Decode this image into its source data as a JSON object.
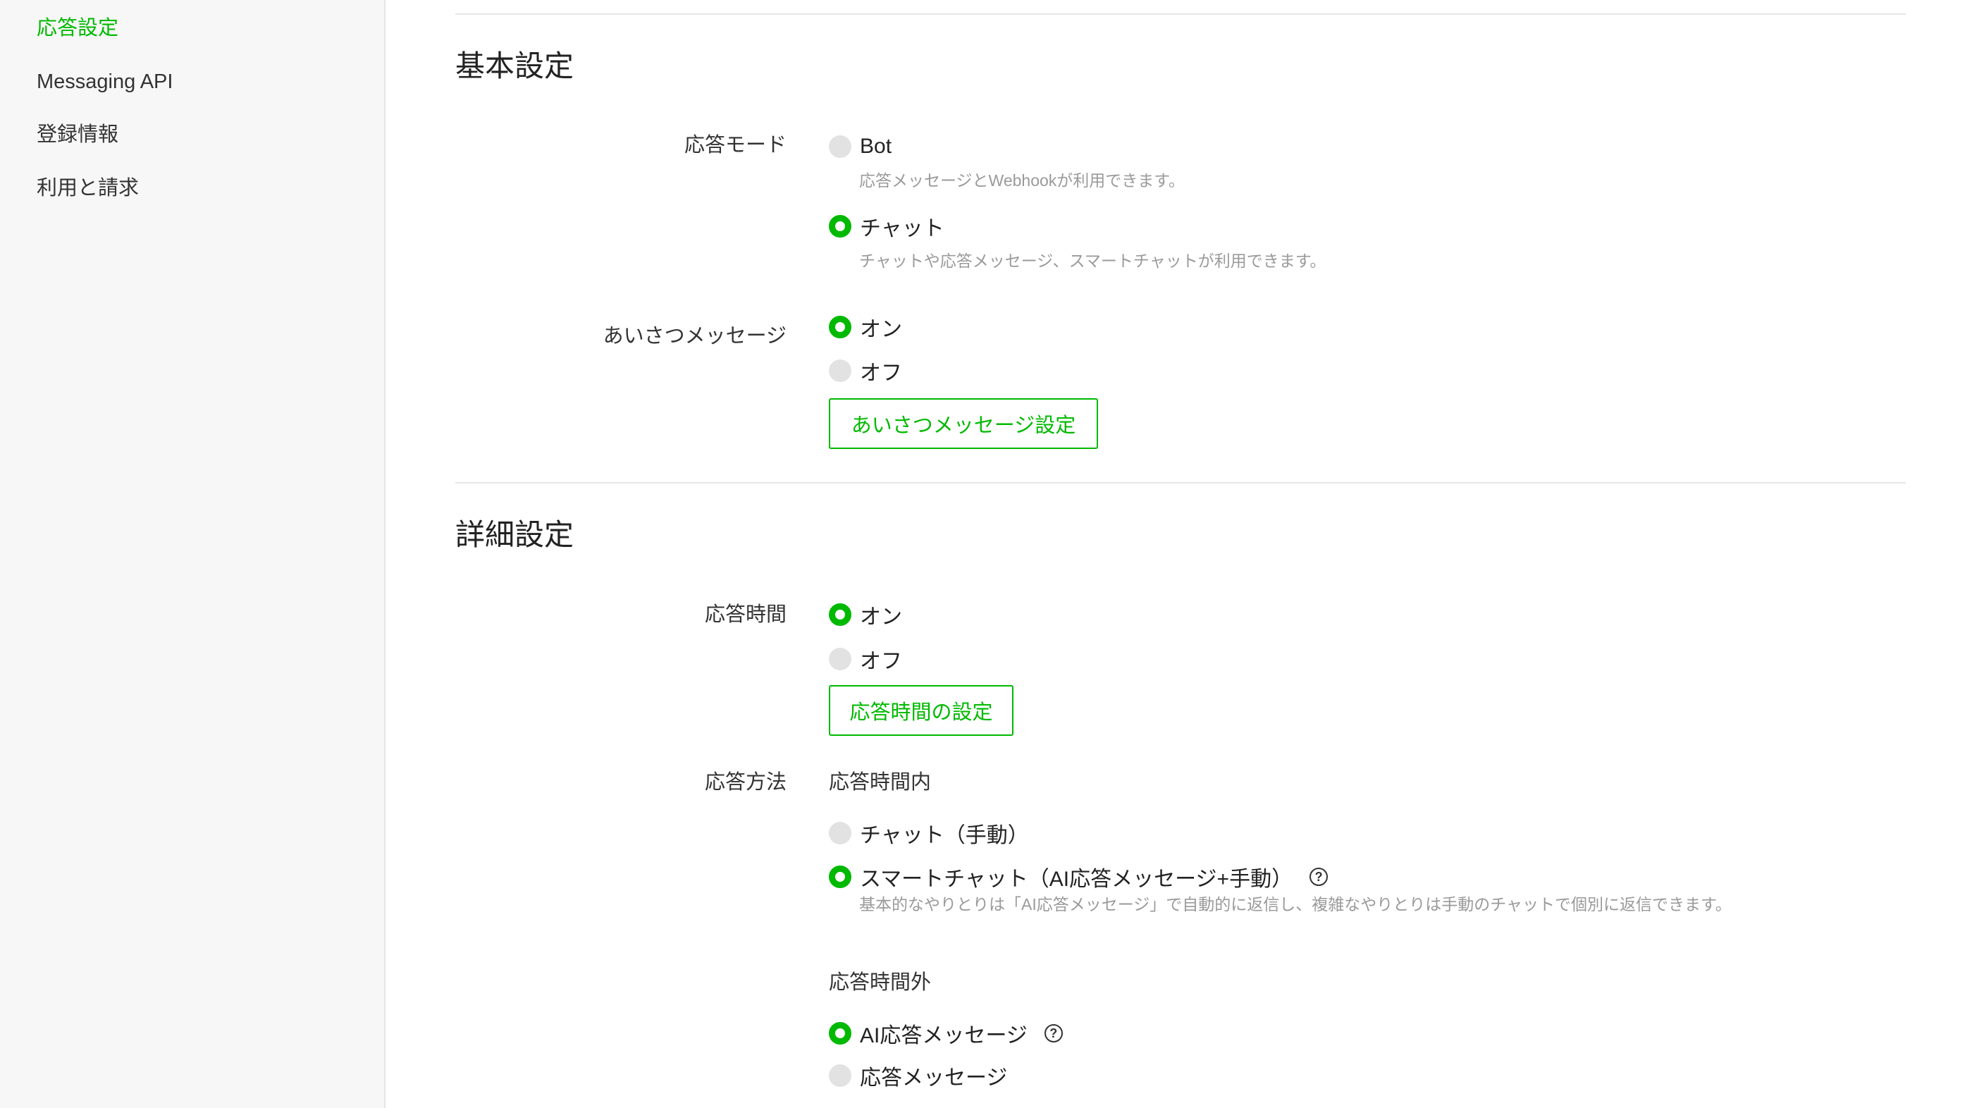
{
  "sidebar": {
    "items": [
      {
        "label": "応答設定",
        "active": true
      },
      {
        "label": "Messaging API"
      },
      {
        "label": "登録情報"
      },
      {
        "label": "利用と請求"
      }
    ]
  },
  "basic": {
    "title": "基本設定",
    "response_mode": {
      "label": "応答モード",
      "options": [
        {
          "label": "Bot",
          "desc": "応答メッセージとWebhookが利用できます。",
          "checked": false
        },
        {
          "label": "チャット",
          "desc": "チャットや応答メッセージ、スマートチャットが利用できます。",
          "checked": true
        }
      ]
    },
    "greeting": {
      "label": "あいさつメッセージ",
      "options": [
        {
          "label": "オン",
          "checked": true
        },
        {
          "label": "オフ",
          "checked": false
        }
      ],
      "button": "あいさつメッセージ設定"
    }
  },
  "advanced": {
    "title": "詳細設定",
    "hours": {
      "label": "応答時間",
      "options": [
        {
          "label": "オン",
          "checked": true
        },
        {
          "label": "オフ",
          "checked": false
        }
      ],
      "button": "応答時間の設定"
    },
    "method": {
      "label": "応答方法",
      "within": {
        "heading": "応答時間内",
        "options": [
          {
            "label": "チャット（手動）",
            "checked": false
          },
          {
            "label": "スマートチャット（AI応答メッセージ+手動）",
            "checked": true,
            "desc": "基本的なやりとりは「AI応答メッセージ」で自動的に返信し、複雑なやりとりは手動のチャットで個別に返信できます。"
          }
        ]
      },
      "outside": {
        "heading": "応答時間外",
        "options": [
          {
            "label": "AI応答メッセージ",
            "checked": true
          },
          {
            "label": "応答メッセージ",
            "checked": false
          }
        ]
      }
    }
  },
  "colors": {
    "accent": "#00b900",
    "radio_off": "#e2e2e2",
    "desc_text": "#9a9a9a"
  },
  "icons": {
    "help": "question-circle-icon"
  }
}
